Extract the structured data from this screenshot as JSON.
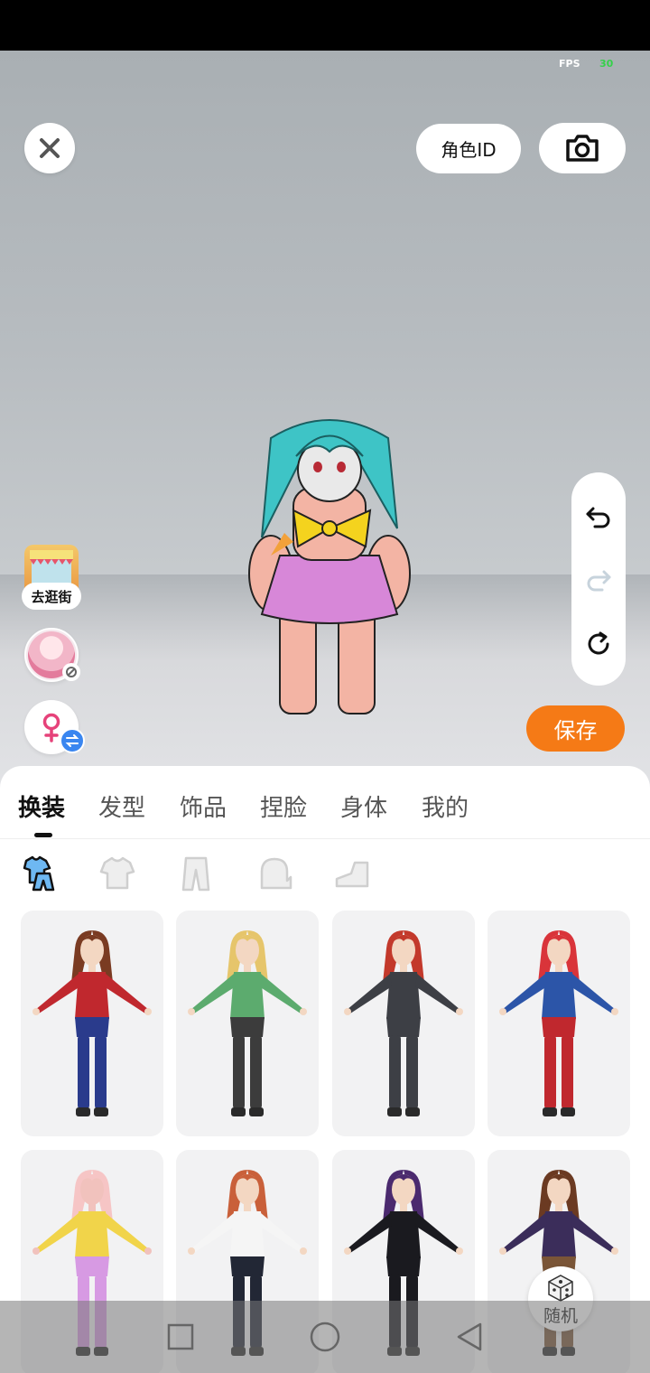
{
  "status": {
    "fps_label": "FPS",
    "fps_value": "30"
  },
  "top": {
    "role_id_label": "角色ID",
    "close_icon": "close-icon",
    "camera_icon": "camera-icon"
  },
  "side_controls": [
    "undo-icon",
    "redo-icon",
    "reset-icon"
  ],
  "left_actions": {
    "shop_label": "去逛街",
    "avatar": "avatar",
    "gender_icon": "female-icon"
  },
  "save_label": "保存",
  "tabs": [
    {
      "label": "换装",
      "active": true
    },
    {
      "label": "发型",
      "active": false
    },
    {
      "label": "饰品",
      "active": false
    },
    {
      "label": "捏脸",
      "active": false
    },
    {
      "label": "身体",
      "active": false
    },
    {
      "label": "我的",
      "active": false
    }
  ],
  "categories": [
    "all-outfit-icon",
    "top-icon",
    "pants-icon",
    "glove-icon",
    "shoe-icon"
  ],
  "outfits": [
    {
      "name": "outfit-wonder",
      "hair": "#7a3b22",
      "top": "#c0282e",
      "bottom": "#2a3b8c",
      "skin": "#f3d7c2"
    },
    {
      "name": "outfit-green-robe",
      "hair": "#e6c56b",
      "top": "#5cab6e",
      "bottom": "#3c3c3c",
      "skin": "#f3d7c2"
    },
    {
      "name": "outfit-black-suit",
      "hair": "#c3392b",
      "top": "#3d3f45",
      "bottom": "#3d3f45",
      "skin": "#f3d7c2"
    },
    {
      "name": "outfit-captain",
      "hair": "#d9343a",
      "top": "#2c55a8",
      "bottom": "#c0282e",
      "skin": "#f3d7c2"
    },
    {
      "name": "outfit-cat-costume",
      "hair": "#f6c5c5",
      "top": "#f1d44a",
      "bottom": "#d79ae3",
      "skin": "#f1c2bd"
    },
    {
      "name": "outfit-sport",
      "hair": "#c9603a",
      "top": "#f5f5f5",
      "bottom": "#222735",
      "skin": "#f3d7c2"
    },
    {
      "name": "outfit-gothic",
      "hair": "#4b2a6e",
      "top": "#1a1a1f",
      "bottom": "#1a1a1f",
      "skin": "#f3d7c2"
    },
    {
      "name": "outfit-academy",
      "hair": "#6b3a22",
      "top": "#3b2d5a",
      "bottom": "#7a5537",
      "skin": "#f3d7c2"
    }
  ],
  "random_label": "随机",
  "nav": [
    "square-nav-icon",
    "circle-nav-icon",
    "back-nav-icon"
  ]
}
